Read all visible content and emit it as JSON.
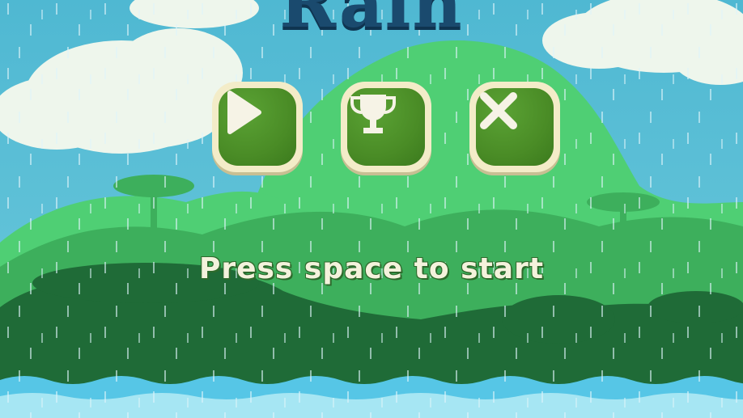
{
  "game": {
    "title": "Rain",
    "prompt": "Press space to start"
  },
  "menu": {
    "play": {
      "icon": "play-icon"
    },
    "leaderboard": {
      "icon": "trophy-icon"
    },
    "exit": {
      "icon": "close-icon"
    }
  },
  "colors": {
    "sky": "#5ec0d8",
    "title": "#1a4a6e",
    "button_frame": "#f3ecc8",
    "button_fill": "#4a8c26",
    "prompt_text": "#f4f2dc",
    "water": "#56c6e6"
  }
}
